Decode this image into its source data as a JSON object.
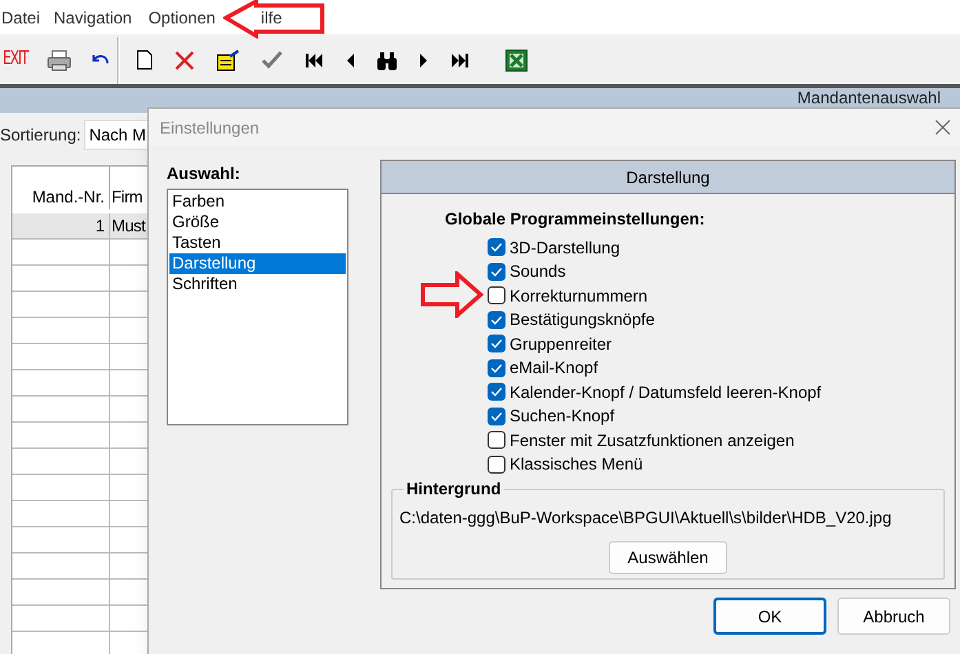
{
  "menu": [
    {
      "label": "Datei"
    },
    {
      "label": "Navigation"
    },
    {
      "label": "Optionen"
    },
    {
      "label": "ilfe"
    }
  ],
  "toolbar": {
    "exit_label": "EXIT"
  },
  "header_title": "Mandantenauswahl",
  "sort": {
    "label": "Sortierung:",
    "value": "Nach M"
  },
  "table": {
    "columns": [
      "Mand.-Nr.",
      "Firm"
    ],
    "rows": [
      [
        "1",
        "Must"
      ]
    ]
  },
  "dialog": {
    "title": "Einstellungen",
    "selection_label": "Auswahl:",
    "items": [
      {
        "label": "Farben",
        "selected": false
      },
      {
        "label": "Größe",
        "selected": false
      },
      {
        "label": "Tasten",
        "selected": false
      },
      {
        "label": "Darstellung",
        "selected": true
      },
      {
        "label": "Schriften",
        "selected": false
      }
    ],
    "panel_title": "Darstellung",
    "group_label": "Globale Programmeinstellungen:",
    "options": [
      {
        "label": "3D-Darstellung",
        "checked": true
      },
      {
        "label": "Sounds",
        "checked": true
      },
      {
        "label": "Korrekturnummern",
        "checked": false
      },
      {
        "label": "Bestätigungsknöpfe",
        "checked": true
      },
      {
        "label": "Gruppenreiter",
        "checked": true
      },
      {
        "label": "eMail-Knopf",
        "checked": true
      },
      {
        "label": "Kalender-Knopf / Datumsfeld leeren-Knopf",
        "checked": true
      },
      {
        "label": "Suchen-Knopf",
        "checked": true
      },
      {
        "label": "Fenster mit Zusatzfunktionen anzeigen",
        "checked": false
      },
      {
        "label": "Klassisches Menü",
        "checked": false
      }
    ],
    "background": {
      "legend": "Hintergrund",
      "path": "C:\\daten-ggg\\BuP-Workspace\\BPGUI\\Aktuell\\s\\bilder\\HDB_V20.jpg",
      "button": "Auswählen"
    },
    "buttons": [
      "OK",
      "Abbruch"
    ]
  }
}
